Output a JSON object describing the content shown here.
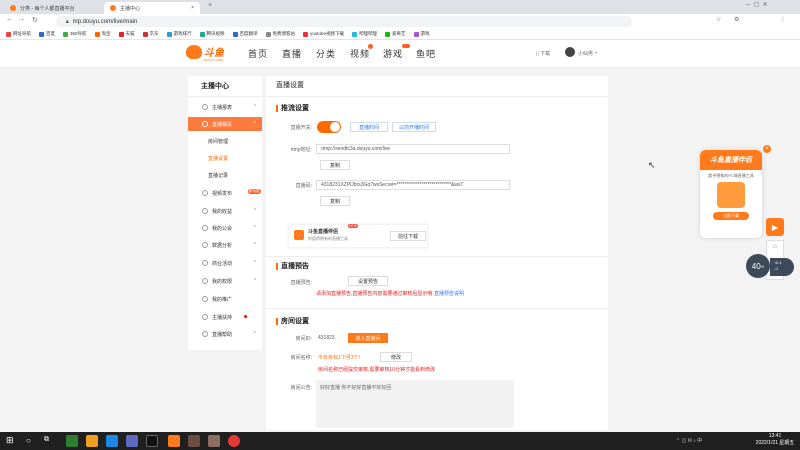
{
  "browser": {
    "tabs": [
      {
        "label": "分类 - 每个人都直播平台",
        "active": false
      },
      {
        "label": "主播中心",
        "active": true
      }
    ],
    "new_tab": "+",
    "url": "mp.douyu.com/live/main",
    "bookmarks": [
      "网址导航",
      "百度",
      "360导航",
      "淘宝",
      "天猫",
      "京东",
      "游戏排行",
      "腾讯视频",
      "百度翻译",
      "免费博客站",
      "youtube视频下载",
      "哔哩哔哩",
      "爱奇艺",
      "游戏"
    ]
  },
  "site": {
    "logo_text": "斗鱼",
    "logo_sub": "DOUYU.COM",
    "nav": [
      {
        "label": "首页",
        "active": false
      },
      {
        "label": "直播",
        "active": false
      },
      {
        "label": "分类",
        "active": false
      },
      {
        "label": "视频",
        "active": false
      },
      {
        "label": "游戏",
        "active": false
      },
      {
        "label": "鱼吧",
        "active": false
      }
    ],
    "header_right": {
      "download": "下载",
      "username": "小仙男"
    }
  },
  "sidebar": {
    "title": "主播中心",
    "items": [
      {
        "label": "主播报表"
      },
      {
        "label": "直播相关"
      },
      {
        "label": "房间管理",
        "sub": true
      },
      {
        "label": "直播设置",
        "sub": true,
        "active": true
      },
      {
        "label": "直播记录",
        "sub": true
      },
      {
        "label": "视频发布",
        "badge": "新功能"
      },
      {
        "label": "我的收益"
      },
      {
        "label": "我的公会"
      },
      {
        "label": "数据分析"
      },
      {
        "label": "商业活动"
      },
      {
        "label": "我的权限"
      },
      {
        "label": "我的推广"
      },
      {
        "label": "主播扶持"
      },
      {
        "label": "直播帮助"
      }
    ]
  },
  "main": {
    "title": "直播设置",
    "stream": {
      "heading": "推流设置",
      "switch_label": "直播开关:",
      "btn_open": "直播时间",
      "btn_record": "以前开播时间",
      "rtmp_label": "rtmp地址:",
      "rtmp_value": "rtmp://sendtc3a.douyu.com/live",
      "copy_btn": "复制",
      "code_label": "直播码:",
      "code_value": "4318231XZPlJbrs3Gq?wsSecret=****************************&wsT",
      "copy_btn2": "复制"
    },
    "promo": {
      "title": "斗鱼直播伴侣",
      "badge": "NEW",
      "subtitle": "你值得拥有的直播工具",
      "button": "前往下载"
    },
    "preview": {
      "heading": "直播预告",
      "label": "直播预告:",
      "button": "设置预告",
      "note": "请添加直播预告,直播预告内容需要通过审核后显示哦",
      "link": "直播预告说明"
    },
    "room": {
      "heading": "房间设置",
      "id_label": "房间ID:",
      "id_value": "431823",
      "enter_btn": "进入直播间",
      "name_label": "房间名称:",
      "name_value": "今日目标1个月3个!",
      "edit_btn": "修改",
      "name_note": "房间名称已经提交审核,需要审核10分钟才能看到修改",
      "notice_label": "房间公告:",
      "notice_value": "好好直播 你不好好直播不好好回"
    }
  },
  "float": {
    "ad_title": "斗鱼直播伴侣",
    "ad_desc": "超乎想象的PC端直播工具",
    "ad_btn": "立即下载",
    "close": "×",
    "net_percent": "40",
    "net_unit": "%",
    "net_up": "0.1",
    "net_down": "1"
  },
  "taskbar": {
    "time": "13:41",
    "date": "2022/1/21 星期五"
  },
  "colors": {
    "accent": "#ff6a00",
    "active_item": "#ff7a3d"
  }
}
